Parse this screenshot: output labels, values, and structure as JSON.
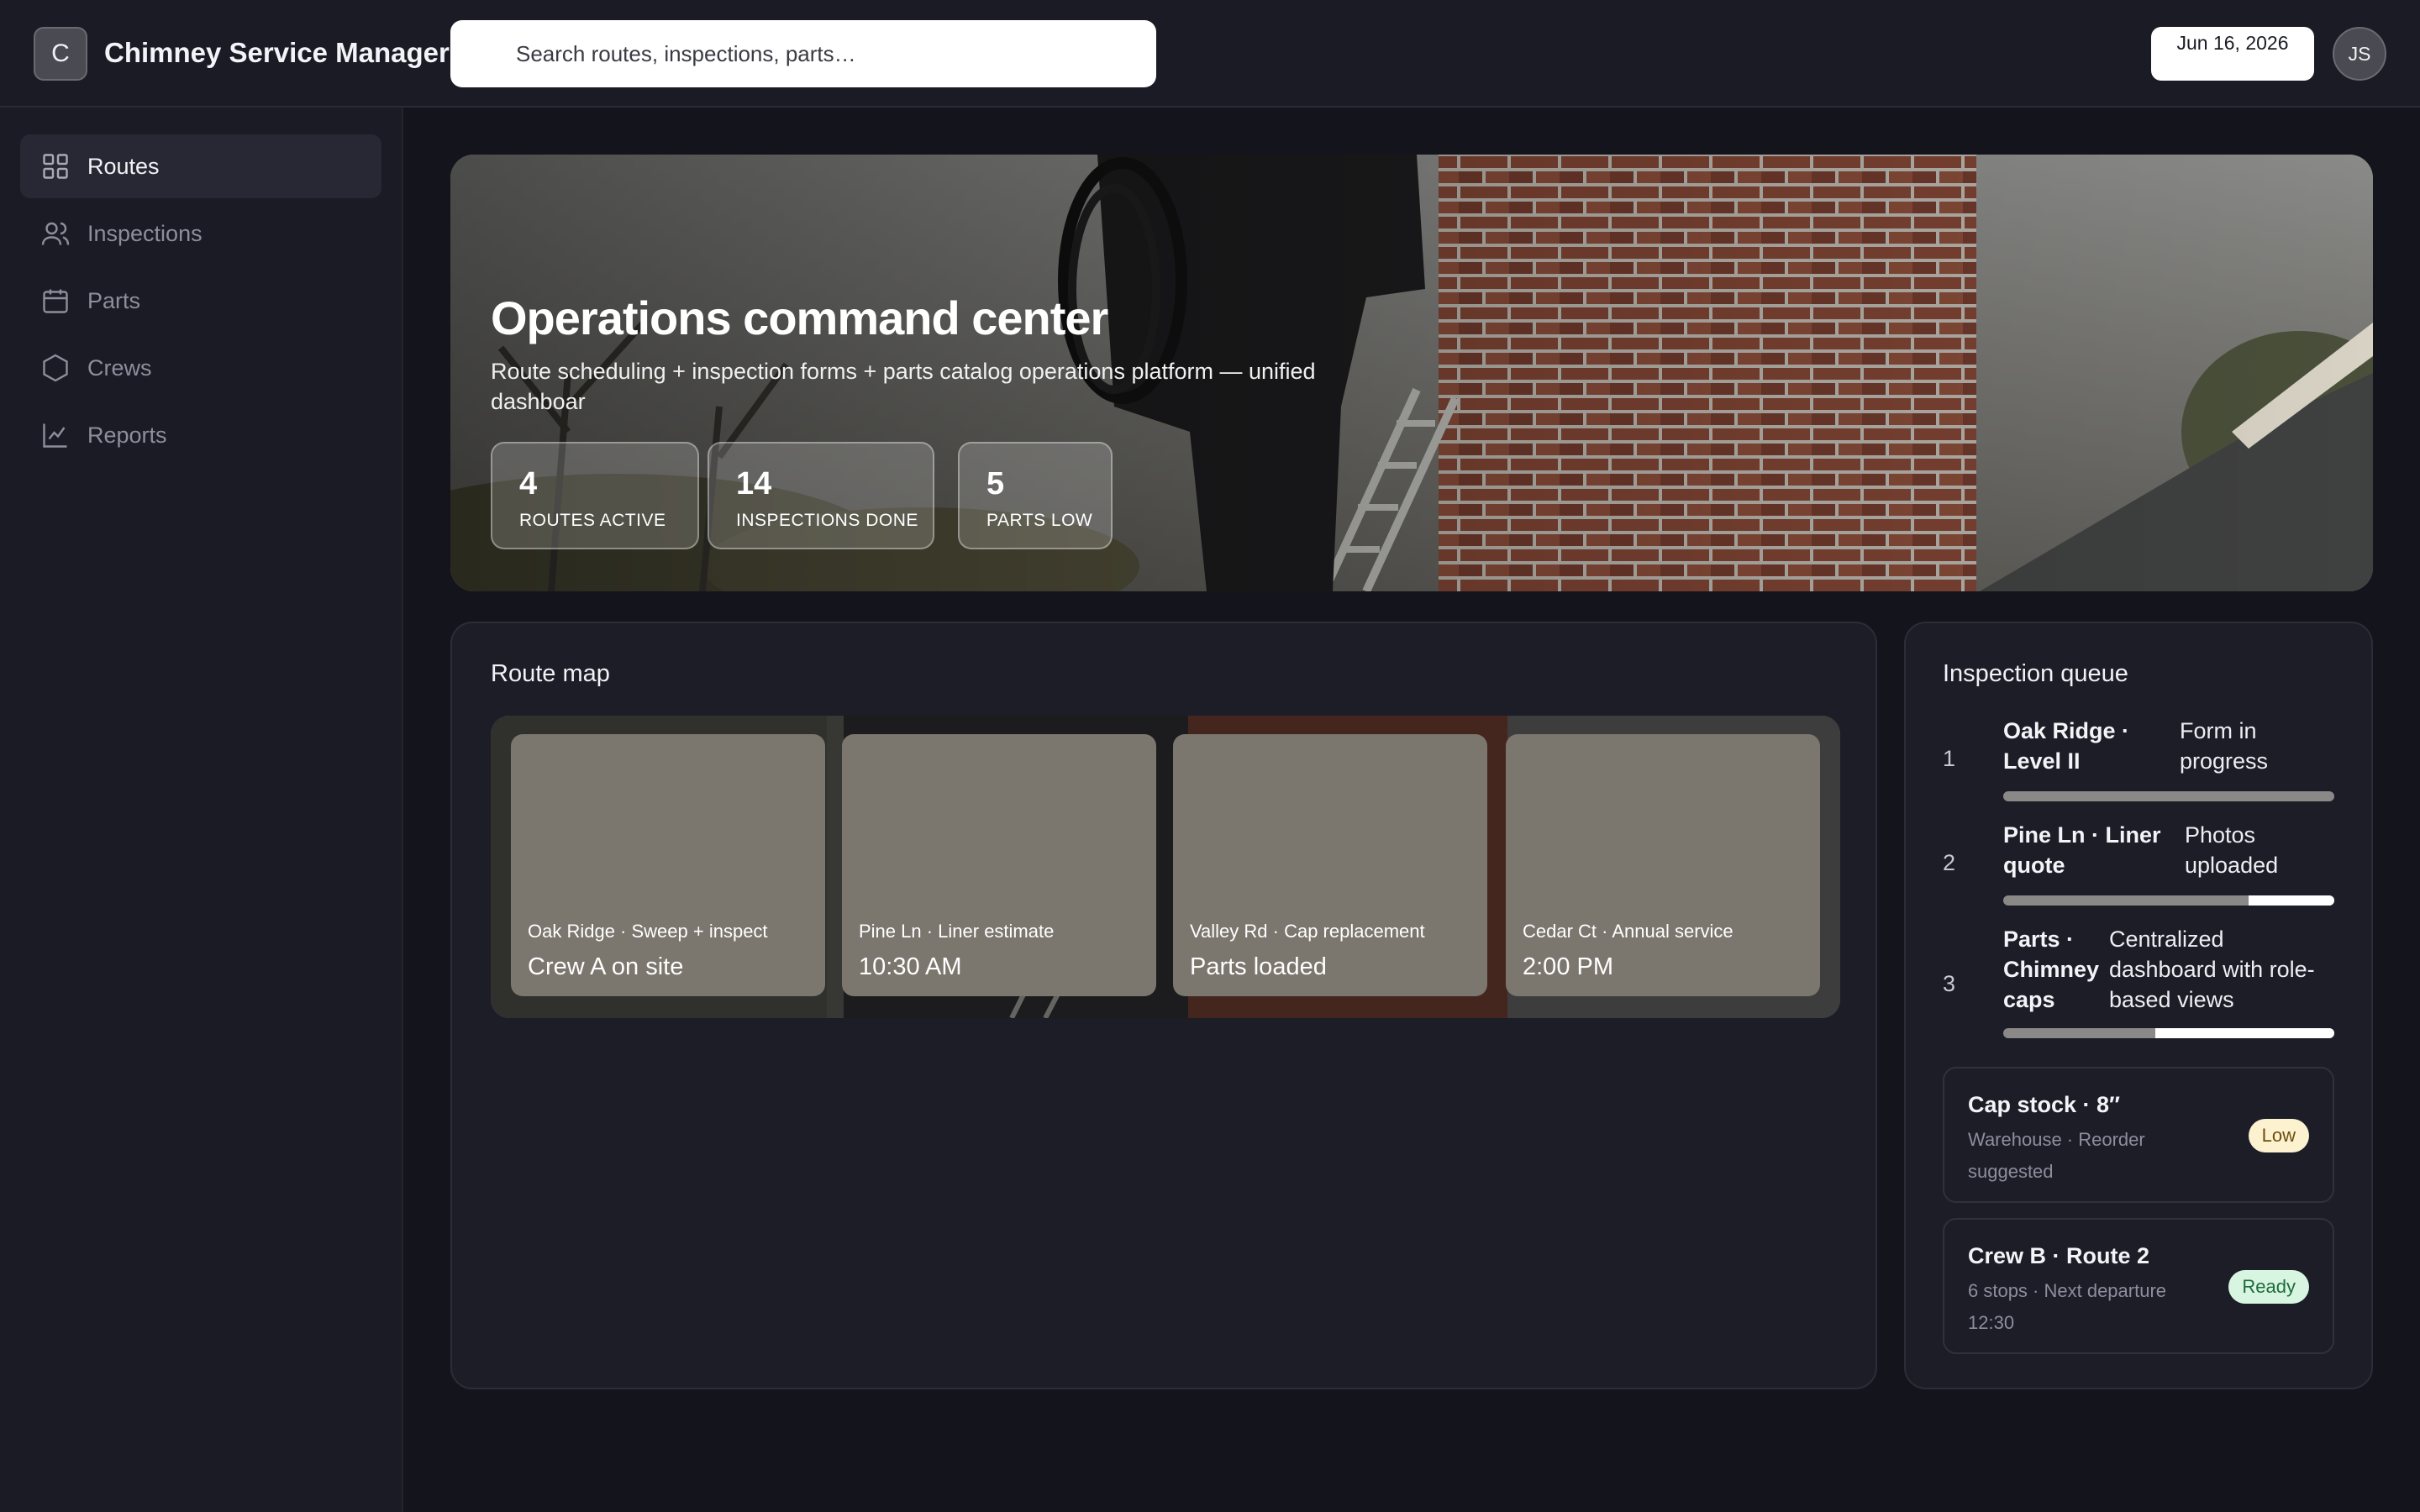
{
  "app": {
    "logo_letter": "C",
    "title": "Chimney Service Manager"
  },
  "header": {
    "search_placeholder": "Search routes, inspections, parts…",
    "date": "Jun 16, 2026",
    "user_initials": "JS"
  },
  "sidebar": {
    "items": [
      {
        "label": "Routes",
        "icon": "grid-icon",
        "active": true
      },
      {
        "label": "Inspections",
        "icon": "users-icon",
        "active": false
      },
      {
        "label": "Parts",
        "icon": "calendar-icon",
        "active": false
      },
      {
        "label": "Crews",
        "icon": "hexagon-icon",
        "active": false
      },
      {
        "label": "Reports",
        "icon": "chart-line-icon",
        "active": false
      }
    ]
  },
  "hero": {
    "title": "Operations command center",
    "subtitle": "Route scheduling + inspection forms + parts catalog operations platform — unified dashboar",
    "stats": [
      {
        "value": "4",
        "label": "ROUTES ACTIVE"
      },
      {
        "value": "14",
        "label": "INSPECTIONS DONE"
      },
      {
        "value": "5",
        "label": "PARTS LOW"
      }
    ]
  },
  "route_map": {
    "title": "Route map",
    "routes": [
      {
        "meta": "Oak Ridge · Sweep + inspect",
        "status": "Crew A on site"
      },
      {
        "meta": "Pine Ln · Liner estimate",
        "status": "10:30 AM"
      },
      {
        "meta": "Valley Rd · Cap replacement",
        "status": "Parts loaded"
      },
      {
        "meta": "Cedar Ct · Annual service",
        "status": "2:00 PM"
      }
    ]
  },
  "inspection_queue": {
    "title": "Inspection queue",
    "items": [
      {
        "num": "1",
        "title": "Oak Ridge · Level II",
        "status": "Form in progress",
        "progress": 0.0
      },
      {
        "num": "2",
        "title": "Pine Ln · Liner quote",
        "status": "Photos uploaded",
        "progress": 0.26
      },
      {
        "num": "3",
        "title": "Parts · Chimney caps",
        "status": "Centralized dashboard with role-based views",
        "progress": 0.54
      }
    ],
    "cards": [
      {
        "title": "Cap stock · 8″",
        "subtitle": "Warehouse · Reorder suggested",
        "badge": "Low",
        "badge_color": "#fdf2cf"
      },
      {
        "title": "Crew B · Route 2",
        "subtitle": "6 stops · Next departure 12:30",
        "badge": "Ready",
        "badge_color": "#d8f5e2"
      }
    ]
  },
  "colors": {
    "background": "#13141c",
    "panel": "#1c1d27",
    "accent_card": "#7b766e"
  }
}
